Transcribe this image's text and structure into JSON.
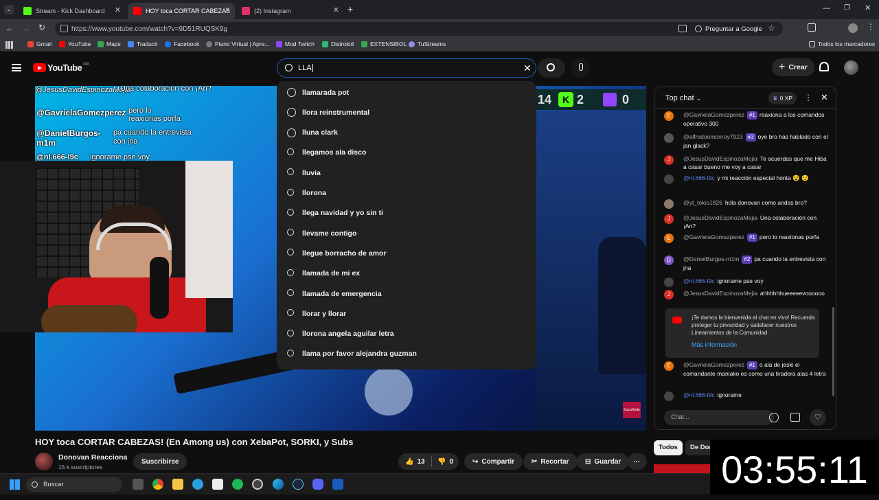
{
  "browser": {
    "tabs": [
      {
        "label": "Stream - Kick Dashboard",
        "icon": "kick-icon",
        "color": "#53fc18"
      },
      {
        "label": "HOY toca CORTAR CABEZAS",
        "icon": "youtube-icon",
        "color": "#ff0000"
      },
      {
        "label": "(2) Instagram",
        "icon": "instagram-icon",
        "color": "#e1306c"
      }
    ],
    "url": "https://www.youtube.com/watch?v=9D51RUQSK9g",
    "translate_label": "Preguntar a Google",
    "bookmarks": [
      {
        "label": "Gmail",
        "color": "#ea4335"
      },
      {
        "label": "YouTube",
        "color": "#ff0000"
      },
      {
        "label": "Maps",
        "color": "#34a853"
      },
      {
        "label": "Traducir",
        "color": "#4285f4"
      },
      {
        "label": "Facebook",
        "color": "#1877f2"
      },
      {
        "label": "Piano Virtual | Apre...",
        "color": "#777777"
      },
      {
        "label": "Mod Twitch",
        "color": "#9146ff"
      },
      {
        "label": "Distrokid",
        "color": "#2bb673"
      },
      {
        "label": "EXTENSIBOL",
        "color": "#34a853"
      },
      {
        "label": "TuStreams",
        "color": "#8e8ee6"
      }
    ],
    "all_bookmarks": "Todos los marcadores"
  },
  "youtube": {
    "logo": "YouTube",
    "region": "MX",
    "search_value": "LLA",
    "create_label": "Crear",
    "suggestions": [
      {
        "text": "llamarada pot",
        "history": true
      },
      {
        "text": "llora reinstrumental",
        "history": true
      },
      {
        "text": "lluna clark",
        "history": true
      },
      {
        "text": "llegamos ala disco",
        "history": false
      },
      {
        "text": "lluvia",
        "history": false
      },
      {
        "text": "llorona",
        "history": false
      },
      {
        "text": "llega navidad y yo sin ti",
        "history": false
      },
      {
        "text": "llevame contigo",
        "history": false
      },
      {
        "text": "llegue borracho de amor",
        "history": false
      },
      {
        "text": "llamada de mi ex",
        "history": false
      },
      {
        "text": "llamada de emergencia",
        "history": false
      },
      {
        "text": "llorar y llorar",
        "history": false
      },
      {
        "text": "llorona angela aguilar letra",
        "history": false
      },
      {
        "text": "llama por favor alejandra guzman",
        "history": false
      }
    ]
  },
  "video": {
    "overlay_chat": [
      {
        "user": "@JesusDavidEspinozaMejia",
        "text": "Una colaboracion con ¡An?"
      },
      {
        "user": "@GavrielaGomezperez",
        "text": "pero lo reaxionas porfa"
      },
      {
        "user": "@DanielBurgos-m1m",
        "text": "pa cuando la entrevista con jna"
      },
      {
        "user": "@nl.666-l9c",
        "text": "ignorame pse voy"
      }
    ],
    "scoreboard": [
      "14",
      "2",
      "0"
    ],
    "title": "HOY toca CORTAR CABEZAS! (En Among us) con XebaPot, SORKI, y Subs",
    "channel": "Donovan Reacciona",
    "subscribers": "15 k suscriptores",
    "subscribe_label": "Suscribirse",
    "likes": "13",
    "dislikes": "0",
    "share_label": "Compartir",
    "clip_label": "Recortar",
    "save_label": "Guardar",
    "subscribe_overlay": "Suscríbete"
  },
  "chat": {
    "header": "Top chat",
    "xp": "0 XP",
    "messages": [
      {
        "author": "@GavrielaGomezperez",
        "badge": "#1",
        "text": "reaxiona a los comandos operativo 300",
        "avatar": "E",
        "color": "#e8710a",
        "blue": false
      },
      {
        "author": "@alfredoomonroy7923",
        "badge": "#3",
        "text": "oye bro has hablado con el jan glack?",
        "avatar": "",
        "color": "#555555",
        "blue": false
      },
      {
        "author": "@JesusDavidEspinozaMejia",
        "badge": "",
        "text": "Te acuerdas que me Hiba a casar bueno me voy a casar",
        "avatar": "J",
        "color": "#d93025",
        "blue": false
      },
      {
        "author": "@nl.666-l9c",
        "badge": "",
        "text": "y mi reacción especial honta 😵 😯",
        "avatar": "",
        "color": "#444444",
        "blue": true
      },
      {
        "author": "@yt_tokio1826",
        "badge": "",
        "text": "hola donovan como andas bro?",
        "avatar": "",
        "color": "#8a7a66",
        "blue": false
      },
      {
        "author": "@JesusDavidEspinozaMejia",
        "badge": "",
        "text": "Una colaboración con ¡An?",
        "avatar": "J",
        "color": "#d93025",
        "blue": false
      },
      {
        "author": "@GavrielaGomezperez",
        "badge": "#1",
        "text": "pero lo reaxionas porfa",
        "avatar": "E",
        "color": "#e8710a",
        "blue": false
      },
      {
        "author": "@DanielBurgos-m1m",
        "badge": "#2",
        "text": "pa cuando la entrevista con jna",
        "avatar": "D",
        "color": "#7e57c2",
        "blue": false
      },
      {
        "author": "@nl.666-l9c",
        "badge": "",
        "text": "ignorame pse voy",
        "avatar": "",
        "color": "#444444",
        "blue": true
      },
      {
        "author": "@JesusDavidEspinozaMejia",
        "badge": "",
        "text": "ahhhhhhueeeeevoooooo",
        "avatar": "J",
        "color": "#d93025",
        "blue": false
      },
      {
        "author": "@GavrielaGomezperez",
        "badge": "#1",
        "text": "o ala de jeski el comandante maniako es como una tiradera alas 4 letra",
        "avatar": "E",
        "color": "#e8710a",
        "blue": false
      },
      {
        "author": "@nl.666-l9c",
        "badge": "",
        "text": "ignorame",
        "avatar": "",
        "color": "#444444",
        "blue": true
      }
    ],
    "welcome_text": "¡Te damos la bienvenida al chat en vivo! Recuerda proteger tu privacidad y satisfacer nuestros Lineamientos de la Comunidad.",
    "welcome_link": "Más información",
    "input_placeholder": "Chat...",
    "filters": [
      "Todos",
      "De Don"
    ]
  },
  "timer": "03:55:11",
  "taskbar": {
    "search_placeholder": "Buscar"
  }
}
